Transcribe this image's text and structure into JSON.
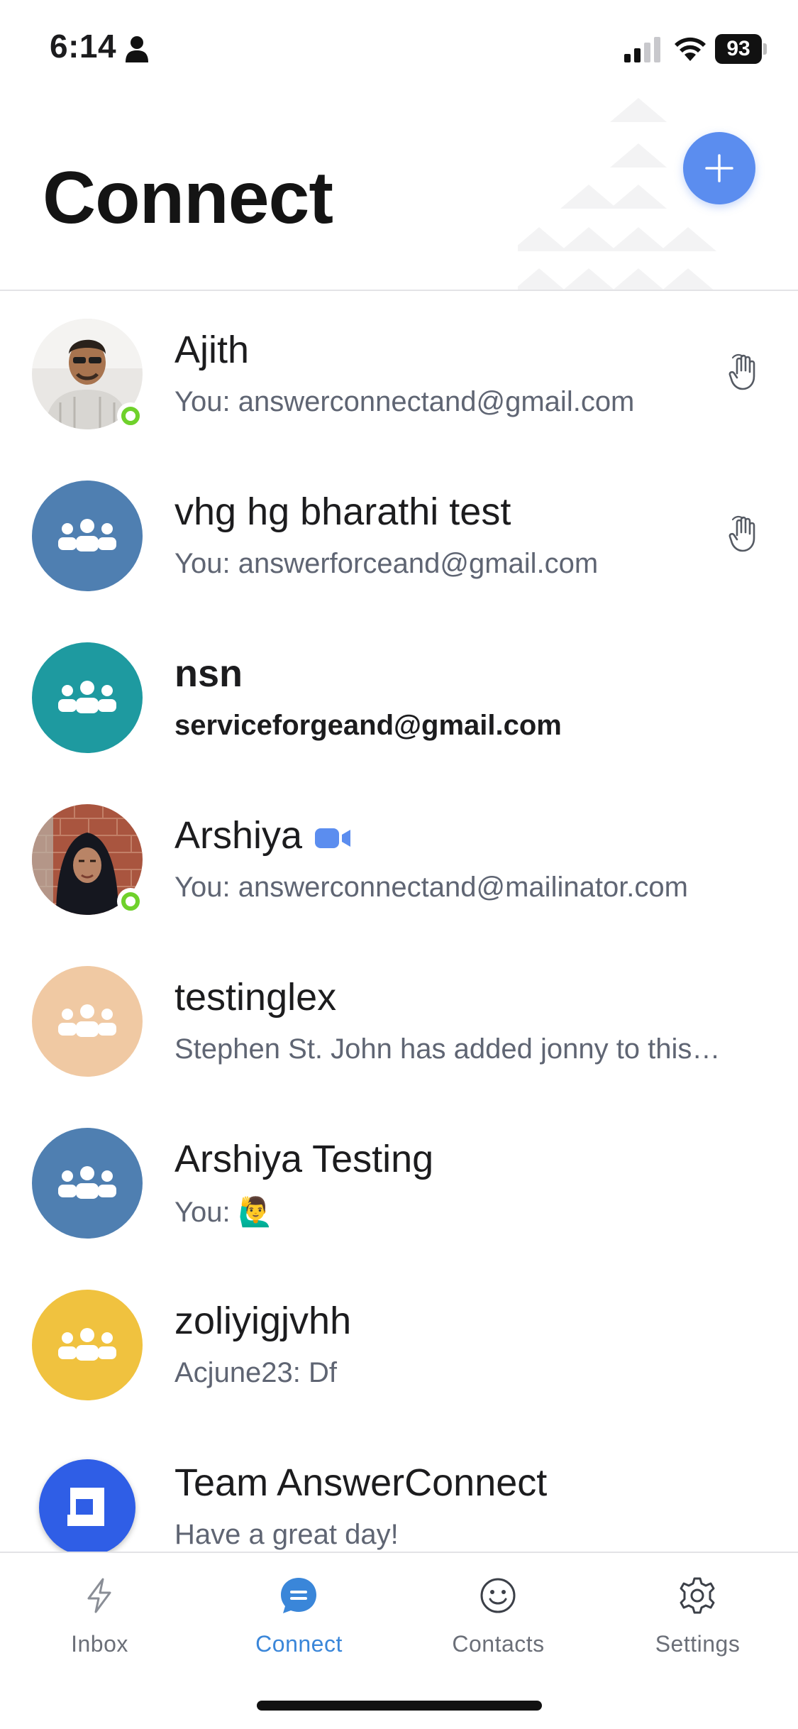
{
  "status_bar": {
    "time": "6:14",
    "battery": "93",
    "icons": [
      "person-icon",
      "signal-icon",
      "wifi-icon",
      "battery-icon"
    ]
  },
  "header": {
    "title": "Connect",
    "add_button_icon": "plus-icon",
    "accent_color": "#5b8def"
  },
  "conversations": [
    {
      "name": "Ajith",
      "preview": "You: answerconnectand@gmail.com",
      "avatar": "photo",
      "online": true,
      "hand_icon": true,
      "unread": false
    },
    {
      "name": "vhg hg bharathi test",
      "preview": "You: answerforceand@gmail.com",
      "avatar": "group",
      "avatar_color": "#4f7fb1",
      "online": false,
      "hand_icon": true,
      "unread": false
    },
    {
      "name": "nsn",
      "preview": "serviceforgeand@gmail.com",
      "avatar": "group",
      "avatar_color": "#1e9aa0",
      "online": false,
      "hand_icon": false,
      "unread": true
    },
    {
      "name": "Arshiya",
      "preview": "You: answerconnectand@mailinator.com",
      "avatar": "photo",
      "online": true,
      "hand_icon": false,
      "video_icon": true,
      "unread": false
    },
    {
      "name": "testinglex",
      "preview": "Stephen St. John has added jonny to this…",
      "avatar": "group",
      "avatar_color": "#f0c9a3",
      "online": false,
      "hand_icon": false,
      "unread": false
    },
    {
      "name": "Arshiya Testing",
      "preview": "You: 🙋‍♂️",
      "avatar": "group",
      "avatar_color": "#4f7fb1",
      "online": false,
      "hand_icon": false,
      "unread": false
    },
    {
      "name": "zoliyigjvhh",
      "preview": "Acjune23: Df",
      "avatar": "group",
      "avatar_color": "#f0c23f",
      "online": false,
      "hand_icon": false,
      "unread": false
    },
    {
      "name": "Team AnswerConnect",
      "preview": "Have a great day!",
      "avatar": "logo",
      "avatar_color": "#2f5ee6",
      "online": false,
      "hand_icon": false,
      "unread": false
    }
  ],
  "bottom_nav": [
    {
      "label": "Inbox",
      "icon": "bolt-icon",
      "active": false
    },
    {
      "label": "Connect",
      "icon": "chat-bubble-icon",
      "active": true
    },
    {
      "label": "Contacts",
      "icon": "smiley-icon",
      "active": false
    },
    {
      "label": "Settings",
      "icon": "gear-icon",
      "active": false
    }
  ]
}
